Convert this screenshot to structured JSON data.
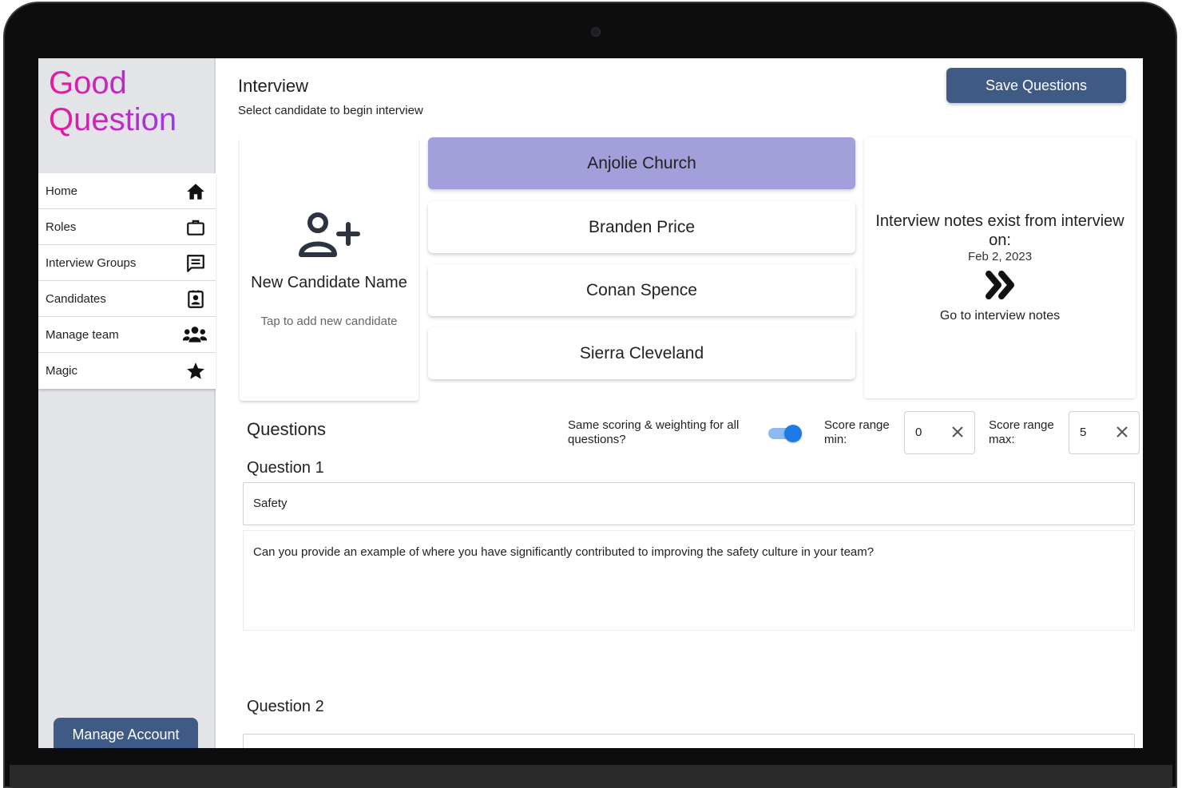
{
  "app": {
    "logo": "Good Question"
  },
  "sidebar": {
    "items": [
      {
        "label": "Home",
        "icon": "home-icon"
      },
      {
        "label": "Roles",
        "icon": "briefcase-icon"
      },
      {
        "label": "Interview Groups",
        "icon": "chat-icon"
      },
      {
        "label": "Candidates",
        "icon": "contact-card-icon"
      },
      {
        "label": "Manage team",
        "icon": "team-icon"
      },
      {
        "label": "Magic",
        "icon": "star-icon"
      }
    ],
    "manage_account": "Manage Account"
  },
  "header": {
    "title": "Interview",
    "subtitle": "Select candidate to begin interview",
    "save_button": "Save Questions"
  },
  "new_candidate": {
    "name": "New Candidate Name",
    "hint": "Tap to add new candidate"
  },
  "candidates": [
    {
      "name": "Anjolie Church",
      "selected": true
    },
    {
      "name": "Branden Price",
      "selected": false
    },
    {
      "name": "Conan Spence",
      "selected": false
    },
    {
      "name": "Sierra Cleveland",
      "selected": false
    }
  ],
  "notes": {
    "title": "Interview notes exist from interview on:",
    "date": "Feb 2, 2023",
    "link": "Go to interview notes"
  },
  "questions": {
    "heading": "Questions",
    "same_scoring_label": "Same scoring & weighting for all questions?",
    "same_scoring_enabled": true,
    "score_min_label": "Score range min:",
    "score_min": "0",
    "score_max_label": "Score range max:",
    "score_max": "5",
    "items": [
      {
        "label": "Question 1",
        "title": "Safety",
        "body": "Can you provide an example of where you have significantly contributed to improving the safety culture in your team?"
      },
      {
        "label": "Question 2",
        "title": "",
        "body": ""
      }
    ]
  },
  "colors": {
    "primary_button": "#3f5a85",
    "selected_candidate": "#a39fdb",
    "toggle_on": "#1e7be6",
    "logo_gradient_start": "#e8189a",
    "logo_gradient_end": "#9b3ae6"
  }
}
